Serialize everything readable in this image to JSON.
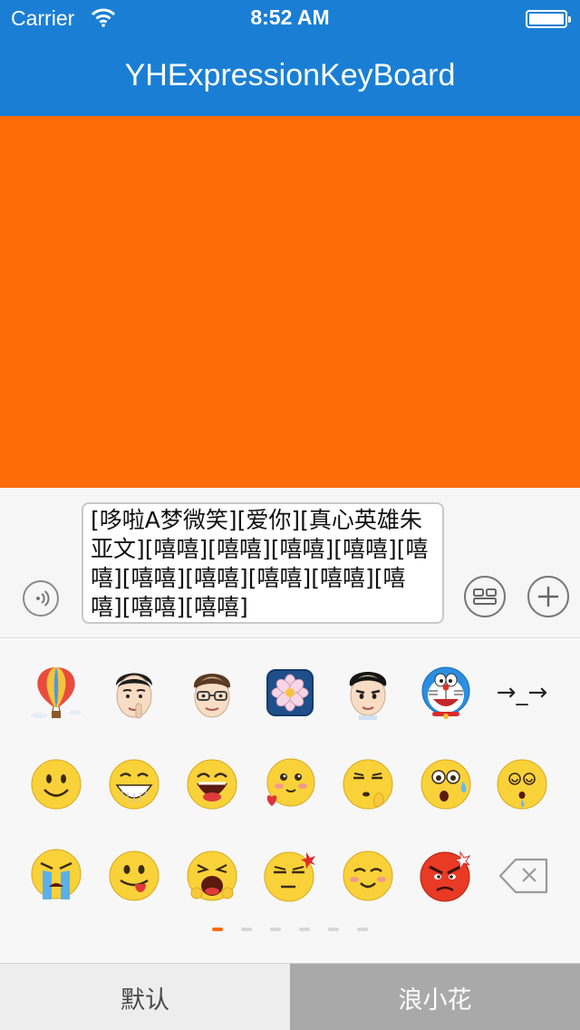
{
  "status": {
    "carrier": "Carrier",
    "time": "8:52 AM"
  },
  "nav": {
    "title": "YHExpressionKeyBoard"
  },
  "input": {
    "text": "[哆啦A梦微笑][爱你][真心英雄朱亚文][嘻嘻][嘻嘻][嘻嘻][嘻嘻][嘻嘻][嘻嘻][嘻嘻][嘻嘻][嘻嘻][嘻嘻][嘻嘻][嘻嘻]",
    "voice_icon": "voice-icon",
    "emoji_toggle_icon": "keyboard-icon",
    "more_icon": "plus-icon"
  },
  "emoji_page": {
    "row1": [
      "balloon",
      "celebrity-finger-on-lips",
      "celebrity-glasses",
      "lotus-flower",
      "celebrity-smile",
      "doraemon",
      "arrow-face"
    ],
    "row1_text": "→_→",
    "row2": [
      "smile",
      "grin",
      "laugh",
      "love",
      "shush",
      "surprised",
      "dizzy"
    ],
    "row3": [
      "cry",
      "tongue",
      "yawn",
      "angry-vein",
      "blush",
      "furious",
      "delete"
    ],
    "page_count": 6,
    "active_page": 1
  },
  "tabs": {
    "default": "默认",
    "flower": "浪小花"
  },
  "colors": {
    "nav": "#1a7fd4",
    "orange": "#ff6b08",
    "tab_active": "#a9a9a9",
    "tab_inactive": "#ededed"
  }
}
